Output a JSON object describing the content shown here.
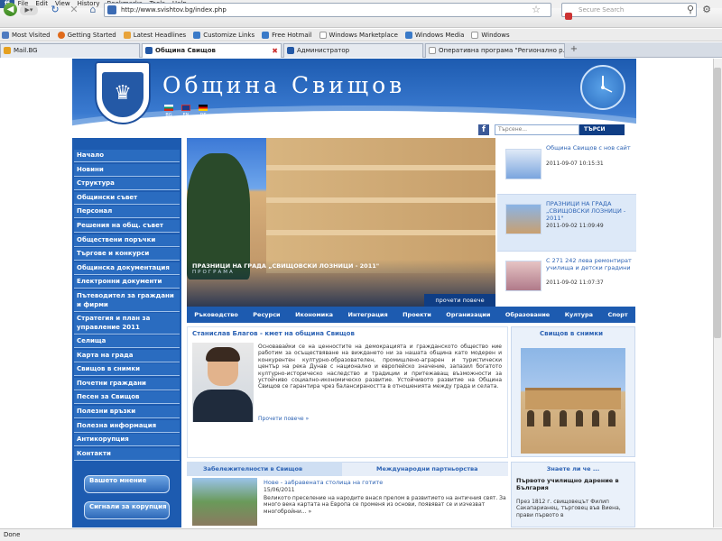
{
  "browser": {
    "menu": [
      "File",
      "Edit",
      "View",
      "History",
      "Bookmarks",
      "Tools",
      "Help"
    ],
    "url": "http://www.svishtov.bg/index.php",
    "search_placeholder": "Secure Search",
    "bookmarks": [
      "Most Visited",
      "Getting Started",
      "Latest Headlines",
      "Customize Links",
      "Free Hotmail",
      "Windows Marketplace",
      "Windows Media",
      "Windows"
    ],
    "tabs": [
      {
        "label": "Mail.BG",
        "active": false
      },
      {
        "label": "Община Свищов",
        "active": true
      },
      {
        "label": "Администратор",
        "active": false
      },
      {
        "label": "Оперативна програма \"Регионално р...",
        "active": false
      }
    ],
    "status": "Done"
  },
  "header": {
    "title": "Община Свищов",
    "languages": [
      "BG",
      "EN",
      "DE"
    ],
    "search_placeholder": "Търсене...",
    "search_button": "ТЪРСИ"
  },
  "sidebar": {
    "items": [
      "Начало",
      "Новини",
      "Структура",
      "Общински съвет",
      "Персонал",
      "Решения на общ. съвет",
      "Обществени поръчки",
      "Търгове и конкурси",
      "Общинска документация",
      "Електронни документи",
      "Пътеводител за граждани и фирми",
      "Стратегия и план за управление 2011",
      "Селища",
      "Карта на града",
      "Свищов в снимки",
      "Почетни граждани",
      "Песен за Свищов",
      "Полезни връзки",
      "Полезна информация",
      "Антикорупция",
      "Контакти"
    ],
    "buttons": [
      "Вашето мнение",
      "Сигнали за корупция"
    ]
  },
  "hero": {
    "title": "ПРАЗНИЦИ НА ГРАДА „СВИЩОВСКИ ЛОЗНИЦИ - 2011\"",
    "subtitle": "ПРОГРАМА",
    "more": "прочети повече"
  },
  "news": [
    {
      "title": "Община Свищов с нов сайт",
      "date": "2011-09-07 10:15:31"
    },
    {
      "title": "ПРАЗНИЦИ НА ГРАДА „СВИЩОВСКИ ЛОЗНИЦИ - 2011\"",
      "date": "2011-09-02 11:09:49"
    },
    {
      "title": "С 271 242 лева ремонтират училища и детски градини",
      "date": "2011-09-02 11:07:37"
    }
  ],
  "category_tabs": [
    "Ръководство",
    "Ресурси",
    "Икономика",
    "Интеграция",
    "Проекти",
    "Организации",
    "Образование",
    "Култура",
    "Спорт"
  ],
  "mayor": {
    "heading": "Станислав Благов - кмет на община Свищов",
    "text": "Основавайки се на ценностите на демокрацията и гражданското общество ние работим за осъществяване на виждането ни за нашата община като модерен и конкурентен културно-образователен, промишлено-аграрен и туристически център на река Дунав с национално и европейско значение, запазил богатото културно-историческо наследство и традиции и притежаващ възможности за устойчиво социално-икономическо развитие. Устойчивото развитие на Община Свищов се гарантира чрез балансираността в отношенията между града и селата.",
    "more": "Прочети повече »"
  },
  "photos": {
    "heading": "Свищов в снимки"
  },
  "subtabs": [
    "Забележителности в Свищов",
    "Международни партньорства"
  ],
  "news2": {
    "title": "Нове - забравената столица на готите",
    "date": "15/06/2011",
    "text": "Великото преселение на народите внася прелом в развитието на античния свят. За много века картата на Европа се променя из основи, появяват се и изчезват многобройни... »"
  },
  "know": {
    "heading": "Знаете ли че ...",
    "subheading": "Първото училищно дарение в България",
    "text": "През 1812 г. свищовецът Филип Сакапарианец, търговец във Виена, прави първото в"
  }
}
